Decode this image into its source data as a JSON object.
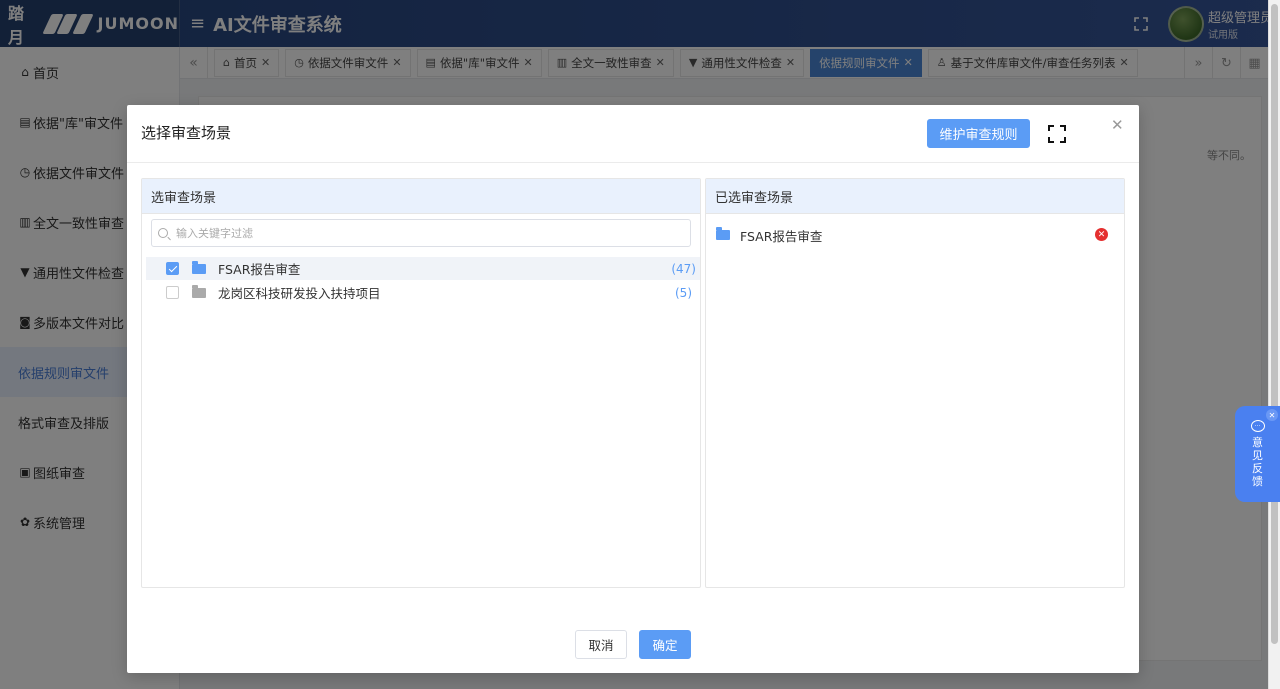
{
  "header": {
    "brand_cn": "踏月",
    "brand_en": "JUMOON",
    "menu_icon": "hamburger-icon",
    "system_title": "AI文件审查系统",
    "user_name": "超级管理员",
    "user_version": "试用版"
  },
  "sidebar": {
    "items": [
      {
        "icon": "home-icon",
        "label": "首页"
      },
      {
        "icon": "document-icon",
        "label": "依据\"库\"审文件"
      },
      {
        "icon": "gauge-icon",
        "label": "依据文件审文件"
      },
      {
        "icon": "file-check-icon",
        "label": "全文一致性审查"
      },
      {
        "icon": "flag-icon",
        "label": "通用性文件检查"
      },
      {
        "icon": "camera-icon",
        "label": "多版本文件对比"
      },
      {
        "icon": "",
        "label": "依据规则审文件"
      },
      {
        "icon": "",
        "label": "格式审查及排版"
      },
      {
        "icon": "image-icon",
        "label": "图纸审查"
      },
      {
        "icon": "gear-icon",
        "label": "系统管理"
      }
    ],
    "active_index": 6
  },
  "tabs": [
    {
      "icon": "home-icon",
      "label": "首页"
    },
    {
      "icon": "gauge-icon",
      "label": "依据文件审文件"
    },
    {
      "icon": "document-icon",
      "label": "依据\"库\"审文件"
    },
    {
      "icon": "file-check-icon",
      "label": "全文一致性审查"
    },
    {
      "icon": "flag-icon",
      "label": "通用性文件检查"
    },
    {
      "icon": "",
      "label": "依据规则审文件"
    },
    {
      "icon": "user-icon",
      "label": "基于文件库审文件/审查任务列表"
    }
  ],
  "active_tab": 5,
  "background": {
    "note": "等不同。"
  },
  "dialog": {
    "title": "选择审查场景",
    "maintain_button": "维护审查规则",
    "left_panel": {
      "title": "选审查场景",
      "filter_placeholder": "输入关键字过滤",
      "items": [
        {
          "label": "FSAR报告审查",
          "count": "(47)",
          "checked": true
        },
        {
          "label": "龙岗区科技研发投入扶持项目",
          "count": "(5)",
          "checked": false
        }
      ]
    },
    "right_panel": {
      "title": "已选审查场景",
      "items": [
        {
          "label": "FSAR报告审查"
        }
      ]
    },
    "cancel": "取消",
    "ok": "确定"
  },
  "feedback": {
    "label": "意见反馈"
  },
  "colors": {
    "header_bg": "#2f4f8e",
    "accent": "#5b9cf5",
    "active_tab": "#4a86d6",
    "feedback": "#4a80f0",
    "remove": "#e53030"
  }
}
